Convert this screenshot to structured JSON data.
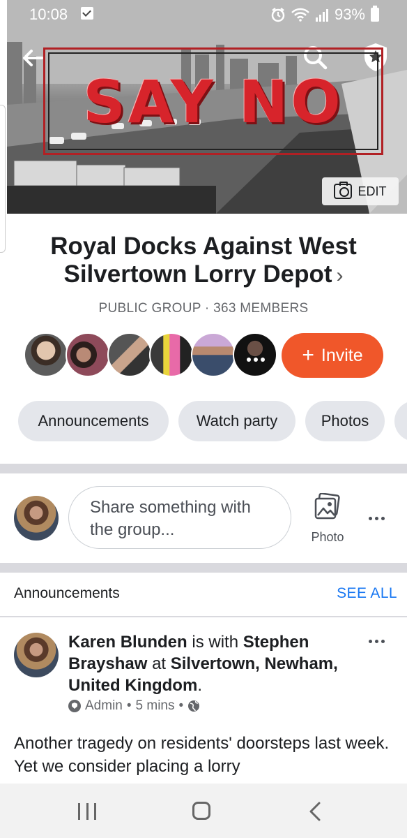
{
  "statusbar": {
    "time": "10:08",
    "battery": "93%"
  },
  "cover": {
    "banner_text": "SAY NO",
    "edit_label": "EDIT"
  },
  "group": {
    "title": "Royal Docks Against West Silvertown Lorry Depot",
    "chevron": "›",
    "meta": "PUBLIC GROUP · 363 MEMBERS"
  },
  "members": {
    "avatars": [
      "member-1",
      "member-2",
      "member-3",
      "member-4",
      "member-5",
      "member-6"
    ],
    "invite_label": "Invite",
    "invite_plus": "+"
  },
  "chips": [
    "Announcements",
    "Watch party",
    "Photos"
  ],
  "composer": {
    "placeholder": "Share something with the group...",
    "photo_label": "Photo"
  },
  "announcements": {
    "header": "Announcements",
    "see_all": "SEE ALL"
  },
  "post": {
    "author": "Karen Blunden",
    "with_word": "is with",
    "tagged": "Stephen Brayshaw",
    "at_word": "at",
    "location": "Silvertown, Newham, United Kingdom",
    "period": ".",
    "role": "Admin",
    "time": "5 mins",
    "sep": "•",
    "body": "Another tragedy on residents' doorsteps last week. Yet we consider placing a lorry"
  },
  "colors": {
    "accent": "#1877f2",
    "invite": "#f0572a",
    "banner_red": "#d7242b",
    "chip_bg": "#e4e6eb"
  },
  "icons": [
    "back-arrow-icon",
    "search-icon",
    "admin-shield-icon",
    "camera-icon",
    "photo-icon",
    "more-icon",
    "globe-icon",
    "alarm-icon",
    "wifi-icon",
    "signal-icon",
    "battery-icon"
  ]
}
